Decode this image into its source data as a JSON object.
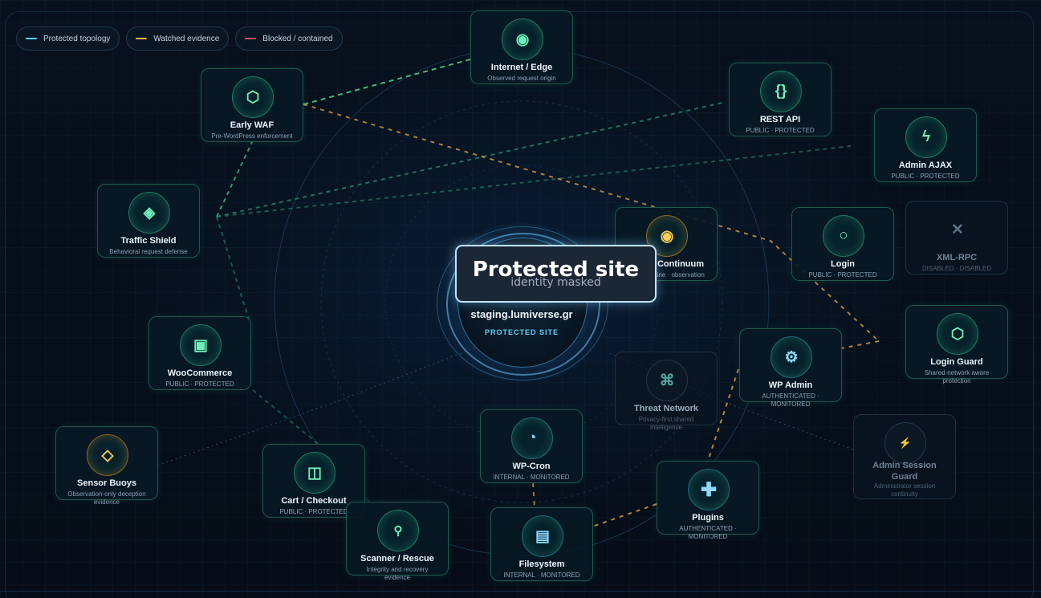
{
  "legend": [
    {
      "label": "Protected topology",
      "color": "#5ad4f0"
    },
    {
      "label": "Watched evidence",
      "color": "#f0b440"
    },
    {
      "label": "Blocked / contained",
      "color": "#f05060"
    }
  ],
  "core": {
    "domain": "staging.lumiverse.gr",
    "badge": "PROTECTED SITE"
  },
  "tooltip": {
    "title": "Protected site",
    "subtitle": "identity masked"
  },
  "nodes": {
    "internet_edge": {
      "title": "Internet / Edge",
      "sub": "Observed request origin",
      "icon": "eye-icon"
    },
    "early_waf": {
      "title": "Early WAF",
      "sub": "Pre-WordPress enforcement",
      "icon": "hexagon-icon"
    },
    "traffic_shield": {
      "title": "Traffic Shield",
      "sub": "Behavioral request defense",
      "icon": "diamond-icon"
    },
    "woocommerce": {
      "title": "WooCommerce",
      "sub": "PUBLIC · PROTECTED",
      "icon": "store-icon"
    },
    "sensor_buoys": {
      "title": "Sensor Buoys",
      "sub": "Observation-only deception evidence",
      "icon": "buoy-icon"
    },
    "cart_checkout": {
      "title": "Cart / Checkout",
      "sub": "PUBLIC · PROTECTED",
      "icon": "cart-icon"
    },
    "scanner_rescue": {
      "title": "Scanner / Rescue",
      "sub": "Integrity and recovery evidence",
      "icon": "magnifier-icon"
    },
    "wp_cron": {
      "title": "WP-Cron",
      "sub": "INTERNAL · MONITORED",
      "icon": "clock-icon"
    },
    "filesystem": {
      "title": "Filesystem",
      "sub": "INTERNAL · MONITORED",
      "icon": "file-stack-icon"
    },
    "plugins": {
      "title": "Plugins",
      "sub": "AUTHENTICATED · MONITORED",
      "icon": "plus-icon"
    },
    "threat_network": {
      "title": "Threat Network",
      "sub": "Privacy-first shared intelligence",
      "icon": "network-icon"
    },
    "wp_admin": {
      "title": "WP Admin",
      "sub": "AUTHENTICATED · MONITORED",
      "icon": "gear-icon"
    },
    "continuum": {
      "title": "Continuum",
      "sub": "gine · observation",
      "icon": "continuum-icon"
    },
    "login": {
      "title": "Login",
      "sub": "PUBLIC · PROTECTED",
      "icon": "circle-icon"
    },
    "xml_rpc": {
      "title": "XML-RPC",
      "sub": "DISABLED · DISABLED",
      "icon": "x-icon"
    },
    "login_guard": {
      "title": "Login Guard",
      "sub": "Shared-network aware protection",
      "icon": "hexagon-icon"
    },
    "admin_session_guard": {
      "title": "Admin Session Guard",
      "sub": "Administrator session continuity",
      "icon": "bolt-icon"
    },
    "rest_api": {
      "title": "REST API",
      "sub": "PUBLIC · PROTECTED",
      "icon": "braces-icon"
    },
    "admin_ajax": {
      "title": "Admin AJAX",
      "sub": "PUBLIC · PROTECTED",
      "icon": "lightning-icon"
    }
  }
}
